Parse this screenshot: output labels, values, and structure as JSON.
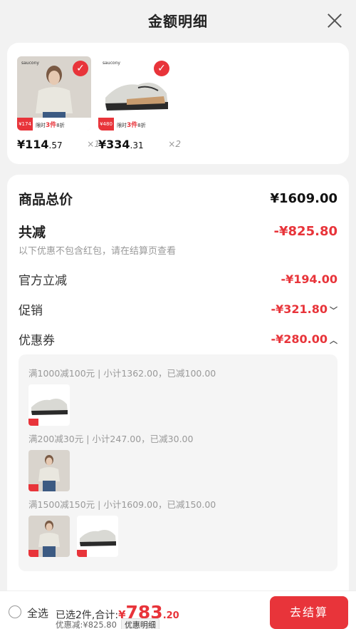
{
  "header": {
    "title": "金额明细"
  },
  "products": [
    {
      "price_int": "¥114",
      "price_dec": ".57",
      "qty": "×1",
      "brand": "saucony",
      "strip_price": "¥174",
      "strip_text": "限时",
      "strip_num": "3件",
      "strip_end": "8折"
    },
    {
      "price_int": "¥334",
      "price_dec": ".31",
      "qty": "×2",
      "brand": "saucony",
      "strip_price": "¥480",
      "strip_text": "限时",
      "strip_num": "3件",
      "strip_end": "8折"
    }
  ],
  "summary": {
    "total_label": "商品总价",
    "total_value": "¥1609.00",
    "discount_label": "共减",
    "discount_value": "-¥825.80",
    "discount_note": "以下优惠不包含红包，请在结算页查看",
    "official_label": "官方立减",
    "official_value": "-¥194.00",
    "promo_label": "促销",
    "promo_value": "-¥321.80",
    "coupon_label": "优惠券",
    "coupon_value": "-¥280.00"
  },
  "coupons": [
    {
      "rule": "满1000减100元 | 小计1362.00，已减100.00"
    },
    {
      "rule": "满200减30元 | 小计247.00，已减30.00"
    },
    {
      "rule": "满1500减150元 | 小计1609.00，已减150.00"
    }
  ],
  "footer": {
    "select_all": "全选",
    "selected_text": "已选2件,合计:",
    "currency": "¥",
    "amount": "783",
    "decimal": ".20",
    "saved_text": "优惠减:¥825.80",
    "detail_tag": "优惠明细",
    "checkout": "去结算"
  },
  "colors": {
    "accent": "#e8343a",
    "background": "#f2f2f2"
  }
}
